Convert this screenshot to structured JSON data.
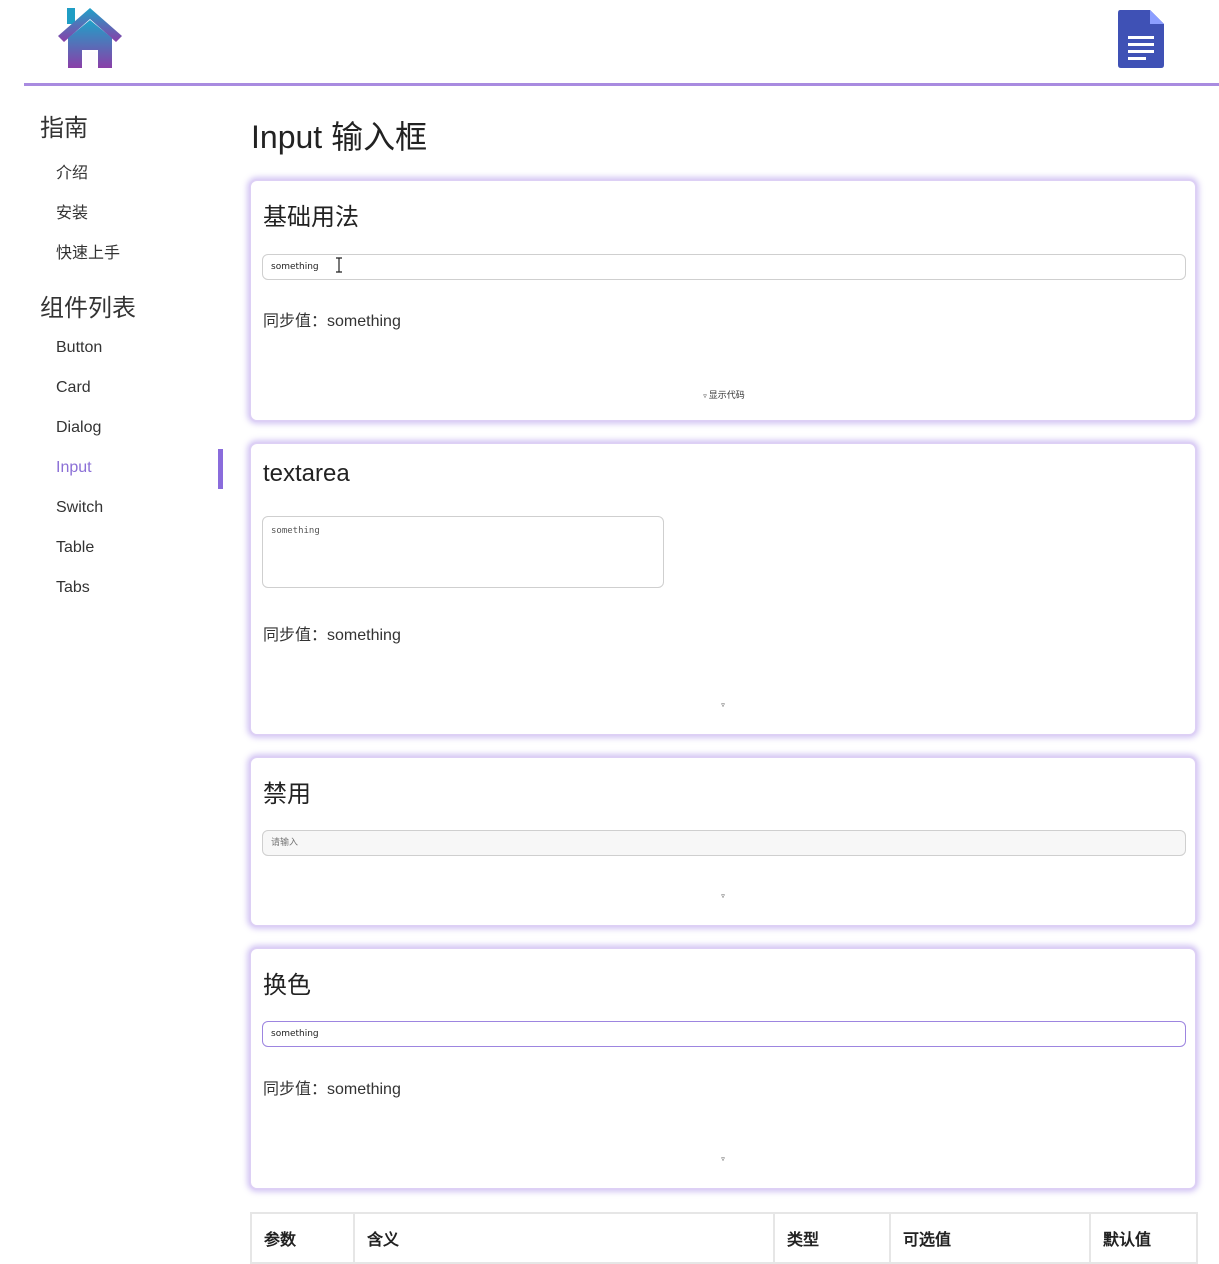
{
  "header": {
    "logo_icon": "house-icon",
    "doc_icon": "document-icon",
    "accent_color": "#a98be0"
  },
  "sidebar": {
    "guide_heading": "指南",
    "guide_items": [
      {
        "label": "介绍"
      },
      {
        "label": "安装"
      },
      {
        "label": "快速上手"
      }
    ],
    "components_heading": "组件列表",
    "component_items": [
      {
        "label": "Button",
        "active": false
      },
      {
        "label": "Card",
        "active": false
      },
      {
        "label": "Dialog",
        "active": false
      },
      {
        "label": "Input",
        "active": true
      },
      {
        "label": "Switch",
        "active": false
      },
      {
        "label": "Table",
        "active": false
      },
      {
        "label": "Tabs",
        "active": false
      }
    ],
    "active_color": "#8b6fd6"
  },
  "main": {
    "title": "Input 输入框",
    "demos": [
      {
        "title": "基础用法",
        "input_value": "something",
        "sync_label": "同步值：",
        "sync_value": "something",
        "toggle_label": "显示代码"
      },
      {
        "title": "textarea",
        "textarea_value": "something",
        "sync_label": "同步值：",
        "sync_value": "something"
      },
      {
        "title": "禁用",
        "input_placeholder": "请输入"
      },
      {
        "title": "换色",
        "input_value": "something",
        "sync_label": "同步值：",
        "sync_value": "something"
      }
    ],
    "table": {
      "headers": [
        "参数",
        "含义",
        "类型",
        "可选值",
        "默认值"
      ]
    }
  }
}
